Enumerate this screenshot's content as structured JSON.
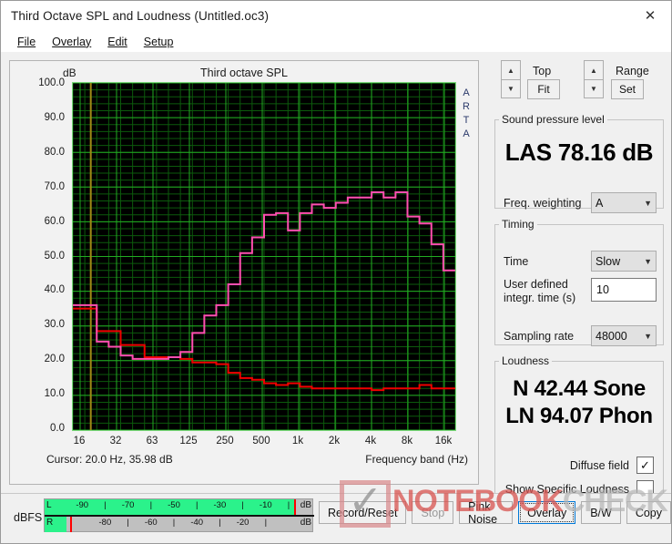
{
  "window": {
    "title": "Third Octave SPL and Loudness (Untitled.oc3)",
    "close_icon": "close-icon"
  },
  "menu": [
    {
      "label": "File"
    },
    {
      "label": "Overlay"
    },
    {
      "label": "Edit"
    },
    {
      "label": "Setup"
    }
  ],
  "graph": {
    "title": "Third octave SPL",
    "y_unit": "dB",
    "watermark_vertical": "ARTA",
    "cursor_text": "Cursor:   20.0 Hz, 35.98 dB",
    "x_axis_title": "Frequency band (Hz)"
  },
  "chart_data": {
    "type": "line",
    "title": "Third octave SPL",
    "xlabel": "Frequency band (Hz)",
    "ylabel": "dB",
    "ylim": [
      0.0,
      100.0
    ],
    "ytick_labels": [
      "100.0",
      "90.0",
      "80.0",
      "70.0",
      "60.0",
      "50.0",
      "40.0",
      "30.0",
      "20.0",
      "10.0",
      "0.0"
    ],
    "xtick_labels": [
      "16",
      "32",
      "63",
      "125",
      "250",
      "500",
      "1k",
      "2k",
      "4k",
      "8k",
      "16k"
    ],
    "grid": true,
    "legend": "none",
    "cursor": {
      "frequency_hz": 20.0,
      "level_db": 35.98,
      "color": "#a08a16"
    },
    "categories": [
      16,
      20,
      25,
      31.5,
      40,
      50,
      63,
      80,
      100,
      125,
      160,
      200,
      250,
      315,
      400,
      500,
      630,
      800,
      1000,
      1250,
      1600,
      2000,
      2500,
      3150,
      4000,
      5000,
      6300,
      8000,
      10000,
      12500,
      16000,
      20000
    ],
    "series": [
      {
        "name": "Third octave SPL (pink trace)",
        "color": "#ff4fb0",
        "values": [
          36.0,
          36.0,
          25.5,
          24.0,
          21.5,
          20.5,
          20.5,
          20.5,
          21.0,
          22.5,
          28.0,
          33.0,
          36.0,
          42.0,
          51.0,
          55.5,
          62.0,
          62.5,
          57.5,
          62.5,
          65.0,
          64.0,
          65.5,
          67.0,
          67.0,
          68.5,
          67.0,
          68.5,
          61.5,
          59.5,
          53.5,
          46.0
        ]
      },
      {
        "name": "Overlay (red trace)",
        "color": "#f00000",
        "values": [
          35.0,
          35.0,
          28.5,
          28.5,
          24.5,
          24.5,
          21.0,
          21.0,
          21.0,
          20.5,
          19.5,
          19.5,
          19.0,
          16.5,
          15.0,
          14.5,
          13.5,
          13.0,
          13.5,
          12.5,
          12.0,
          12.0,
          12.0,
          12.0,
          12.0,
          11.5,
          12.0,
          12.0,
          12.0,
          13.0,
          12.0,
          12.0
        ]
      }
    ],
    "plot_bg": "#000000",
    "grid_color": "#0c5a0c",
    "grid_major_color": "#22aa22"
  },
  "controls": {
    "top": {
      "label": "Top",
      "button": "Fit",
      "up_icon": "spinner-up-icon",
      "down_icon": "spinner-down-icon"
    },
    "range": {
      "label": "Range",
      "button": "Set",
      "up_icon": "spinner-up-icon",
      "down_icon": "spinner-down-icon"
    }
  },
  "spl_panel": {
    "legend": "Sound pressure level",
    "value": "LAS 78.16 dB",
    "weighting_label": "Freq. weighting",
    "weighting_value": "A"
  },
  "timing_panel": {
    "legend": "Timing",
    "time_label": "Time",
    "time_value": "Slow",
    "integration_label_line1": "User defined",
    "integration_label_line2": "integr. time (s)",
    "integration_value": "10",
    "sampling_label": "Sampling rate",
    "sampling_value": "48000"
  },
  "loudness_panel": {
    "legend": "Loudness",
    "sone": "N 42.44 Sone",
    "phon": "LN 94.07 Phon",
    "diffuse_label": "Diffuse field",
    "diffuse_checked": "✓",
    "specific_label": "Show Specific Loudness",
    "specific_checked": ""
  },
  "meter": {
    "label": "dBFS",
    "left": {
      "channel": "L",
      "unit": "dB",
      "fill_percent": 93,
      "marker_percent": 92.5,
      "ticks": [
        "-90",
        "-70",
        "-50",
        "-30",
        "-10"
      ]
    },
    "right": {
      "channel": "R",
      "unit": "dB",
      "fill_percent": 8,
      "marker_percent": 9.5,
      "ticks": [
        "-80",
        "-60",
        "-40",
        "-20"
      ]
    }
  },
  "buttons": [
    {
      "label": "Record/Reset",
      "state": "normal"
    },
    {
      "label": "Stop",
      "state": "disabled"
    },
    {
      "label": "Pink Noise",
      "state": "normal"
    },
    {
      "label": "Overlay",
      "state": "focused"
    },
    {
      "label": "B/W",
      "state": "normal"
    },
    {
      "label": "Copy",
      "state": "normal"
    }
  ],
  "watermark": {
    "brand_1": "NOTEBOOK",
    "brand_2": "CHECK"
  }
}
